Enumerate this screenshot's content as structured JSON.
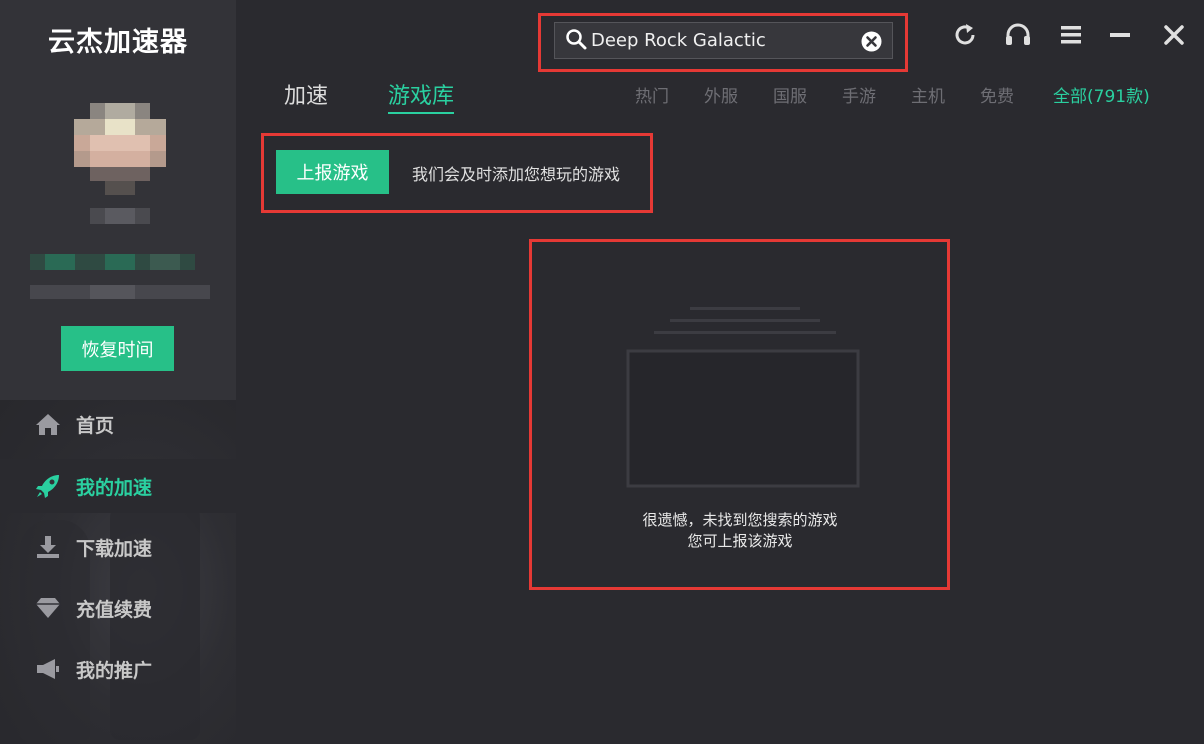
{
  "app": {
    "title": "云杰加速器"
  },
  "sidebar": {
    "restore_label": "恢复时间",
    "items": [
      {
        "label": "首页",
        "icon": "home-icon",
        "active": false
      },
      {
        "label": "我的加速",
        "icon": "rocket-icon",
        "active": true
      },
      {
        "label": "下载加速",
        "icon": "download-icon",
        "active": false
      },
      {
        "label": "充值续费",
        "icon": "diamond-icon",
        "active": false
      },
      {
        "label": "我的推广",
        "icon": "megaphone-icon",
        "active": false
      }
    ]
  },
  "header": {
    "search": {
      "value": "Deep Rock Galactic",
      "placeholder": ""
    }
  },
  "tabs": [
    {
      "label": "加速",
      "active": false
    },
    {
      "label": "游戏库",
      "active": true
    }
  ],
  "filters": [
    {
      "label": "热门",
      "active": false
    },
    {
      "label": "外服",
      "active": false
    },
    {
      "label": "国服",
      "active": false
    },
    {
      "label": "手游",
      "active": false
    },
    {
      "label": "主机",
      "active": false
    },
    {
      "label": "免费",
      "active": false
    },
    {
      "label": "全部(791款)",
      "active": true
    }
  ],
  "report": {
    "button_label": "上报游戏",
    "hint": "我们会及时添加您想玩的游戏"
  },
  "empty_state": {
    "line1": "很遗憾，未找到您搜索的游戏",
    "line2": "您可上报该游戏"
  },
  "colors": {
    "accent": "#27c088",
    "accent_text": "#2ad0a0",
    "highlight": "#e53935"
  }
}
